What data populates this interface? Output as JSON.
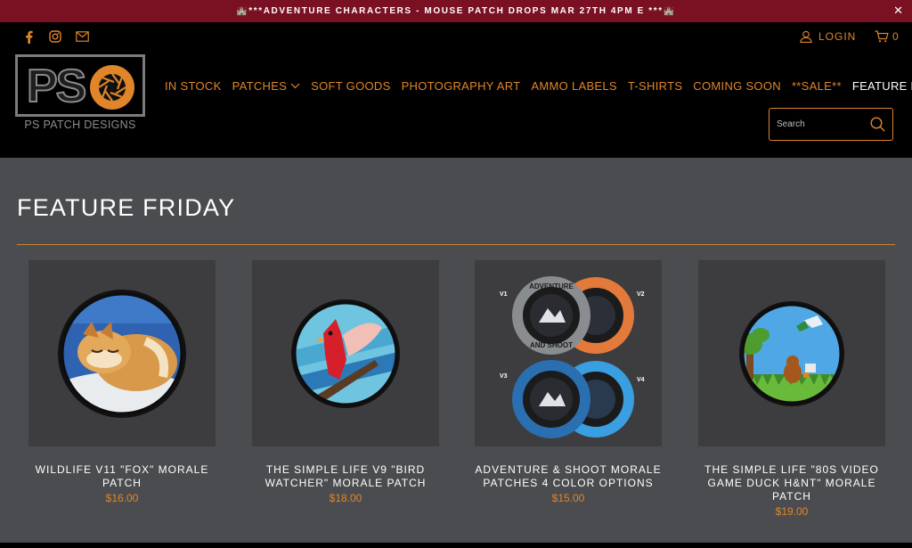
{
  "announcement": {
    "text": "🏰***ADVENTURE CHARACTERS - MOUSE PATCH DROPS MAR 27TH 4PM E ***🏰",
    "close": "✕"
  },
  "header": {
    "social": [
      {
        "icon": "facebook-icon"
      },
      {
        "icon": "instagram-icon"
      },
      {
        "icon": "email-icon"
      }
    ],
    "login_label": "LOGIN",
    "cart_count": "0"
  },
  "logo": {
    "letters": "PS",
    "name": "PS PATCH DESIGNS"
  },
  "nav": {
    "items": [
      {
        "label": "IN STOCK"
      },
      {
        "label": "PATCHES"
      },
      {
        "label": "SOFT GOODS"
      },
      {
        "label": "PHOTOGRAPHY ART"
      },
      {
        "label": "AMMO LABELS"
      },
      {
        "label": "T-SHIRTS"
      },
      {
        "label": "COMING SOON"
      },
      {
        "label": "**SALE**"
      },
      {
        "label": "FEATURE FRIDAY"
      }
    ]
  },
  "search": {
    "placeholder": "Search"
  },
  "page": {
    "title": "FEATURE FRIDAY"
  },
  "products": [
    {
      "name": "WILDLIFE V11 \"FOX\" MORALE PATCH",
      "price": "$16.00"
    },
    {
      "name": "THE SIMPLE LIFE V9 \"BIRD WATCHER\" MORALE PATCH",
      "price": "$18.00"
    },
    {
      "name": "ADVENTURE & SHOOT MORALE PATCHES 4 COLOR OPTIONS",
      "price": "$15.00",
      "variants": [
        "V1",
        "V2",
        "V3",
        "V4"
      ],
      "ring_top": "ADVENTURE",
      "ring_bottom": "AND SHOOT"
    },
    {
      "name": "THE SIMPLE LIFE \"80S VIDEO GAME DUCK H&NT\" MORALE PATCH",
      "price": "$19.00"
    }
  ],
  "colors": {
    "accent": "#e0852a",
    "announcement_bg": "#7a1123",
    "header_bg": "#000000",
    "page_bg": "#4b4c4f"
  }
}
